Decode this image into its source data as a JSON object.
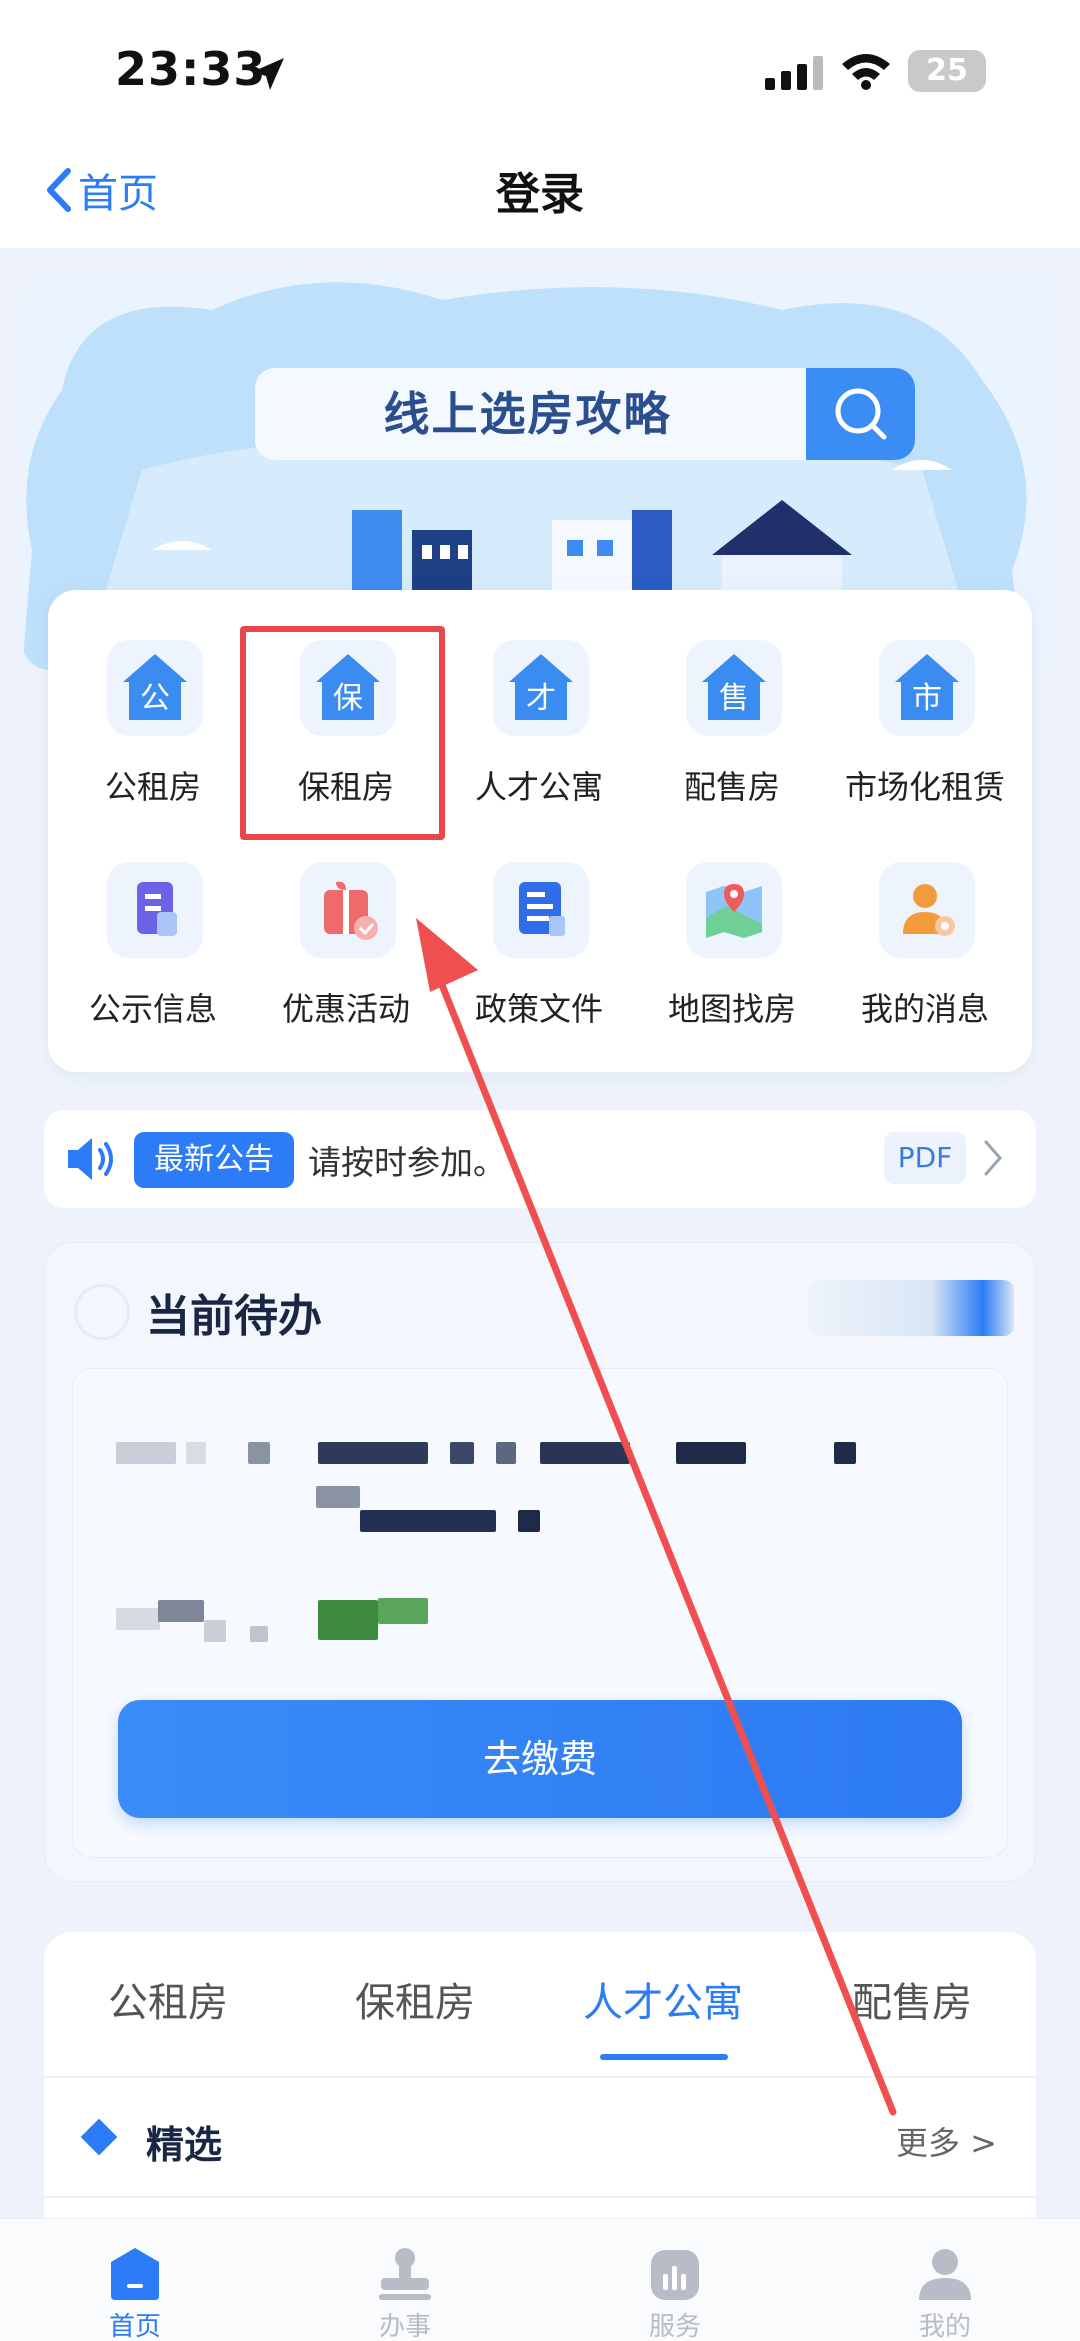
{
  "status_bar": {
    "time": "23:33",
    "battery": "25"
  },
  "nav": {
    "back_label": "首页",
    "title": "登录"
  },
  "banner": {
    "search_text": "线上选房攻略"
  },
  "grid": {
    "items": [
      {
        "label": "公租房",
        "glyph": "公",
        "icon": "public-housing-icon"
      },
      {
        "label": "保租房",
        "glyph": "保",
        "icon": "affordable-rental-icon"
      },
      {
        "label": "人才公寓",
        "glyph": "才",
        "icon": "talent-apartment-icon"
      },
      {
        "label": "配售房",
        "glyph": "售",
        "icon": "allocated-sale-icon"
      },
      {
        "label": "市场化租赁",
        "glyph": "市",
        "icon": "market-rental-icon"
      },
      {
        "label": "公示信息",
        "glyph": "",
        "icon": "document-icon"
      },
      {
        "label": "优惠活动",
        "glyph": "",
        "icon": "gift-icon"
      },
      {
        "label": "政策文件",
        "glyph": "",
        "icon": "policy-file-icon"
      },
      {
        "label": "地图找房",
        "glyph": "",
        "icon": "map-icon"
      },
      {
        "label": "我的消息",
        "glyph": "",
        "icon": "message-user-icon"
      }
    ]
  },
  "notice": {
    "tag": "最新公告",
    "text": "请按时参加。",
    "pdf_label": "PDF"
  },
  "todo": {
    "title": "当前待办",
    "pay_button": "去缴费"
  },
  "tabs": {
    "items": [
      "公租房",
      "保租房",
      "人才公寓",
      "配售房"
    ],
    "active_index": 2
  },
  "featured": {
    "title": "精选",
    "more": "更多 >"
  },
  "bottom_nav": {
    "items": [
      {
        "label": "首页",
        "icon": "home-icon"
      },
      {
        "label": "办事",
        "icon": "stamp-icon"
      },
      {
        "label": "服务",
        "icon": "service-chart-icon"
      },
      {
        "label": "我的",
        "icon": "profile-icon"
      }
    ]
  },
  "colors": {
    "accent": "#2b7cf6",
    "annotation": "#e8464a",
    "background": "#eef3fb"
  }
}
